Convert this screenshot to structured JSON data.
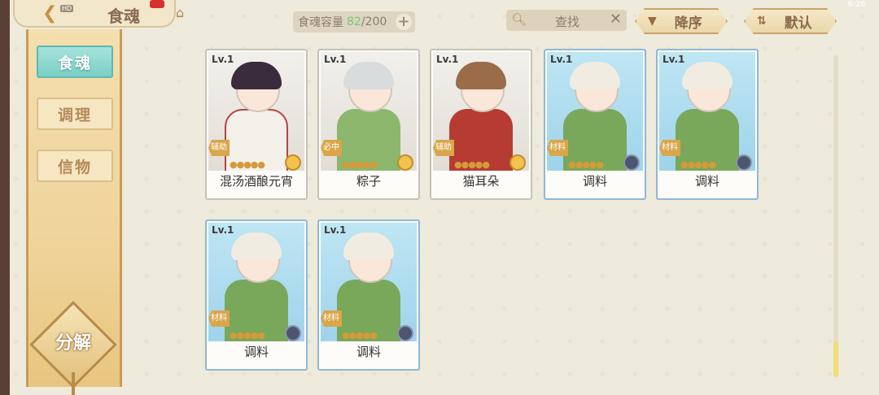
{
  "header": {
    "title": "食魂",
    "hd": "HD",
    "capacity_label": "食魂容量",
    "capacity_current": "82",
    "capacity_max": "/200",
    "search_label": "查找",
    "sort_label": "降序",
    "default_label": "默认",
    "status_time": "6:26"
  },
  "sidebar": {
    "tabs": [
      {
        "label": "食魂",
        "active": true
      },
      {
        "label": "调理",
        "active": false
      },
      {
        "label": "信物",
        "active": false
      }
    ],
    "decompose_label": "分解"
  },
  "cards": [
    {
      "level": "Lv.1",
      "name": "混汤酒酿元宵",
      "role": "辅助",
      "element": "gold"
    },
    {
      "level": "Lv.1",
      "name": "粽子",
      "role": "必中",
      "element": "gold"
    },
    {
      "level": "Lv.1",
      "name": "猫耳朵",
      "role": "辅助",
      "element": "gold"
    },
    {
      "level": "Lv.1",
      "name": "调料",
      "role": "材料",
      "element": "dark"
    },
    {
      "level": "Lv.1",
      "name": "调料",
      "role": "材料",
      "element": "dark"
    },
    {
      "level": "Lv.1",
      "name": "调料",
      "role": "材料",
      "element": "dark"
    },
    {
      "level": "Lv.1",
      "name": "调料",
      "role": "材料",
      "element": "dark"
    }
  ],
  "colors": {
    "accent_teal": "#7ccfc6",
    "gold": "#d9a64a",
    "capacity_current": "#7cc76f"
  }
}
